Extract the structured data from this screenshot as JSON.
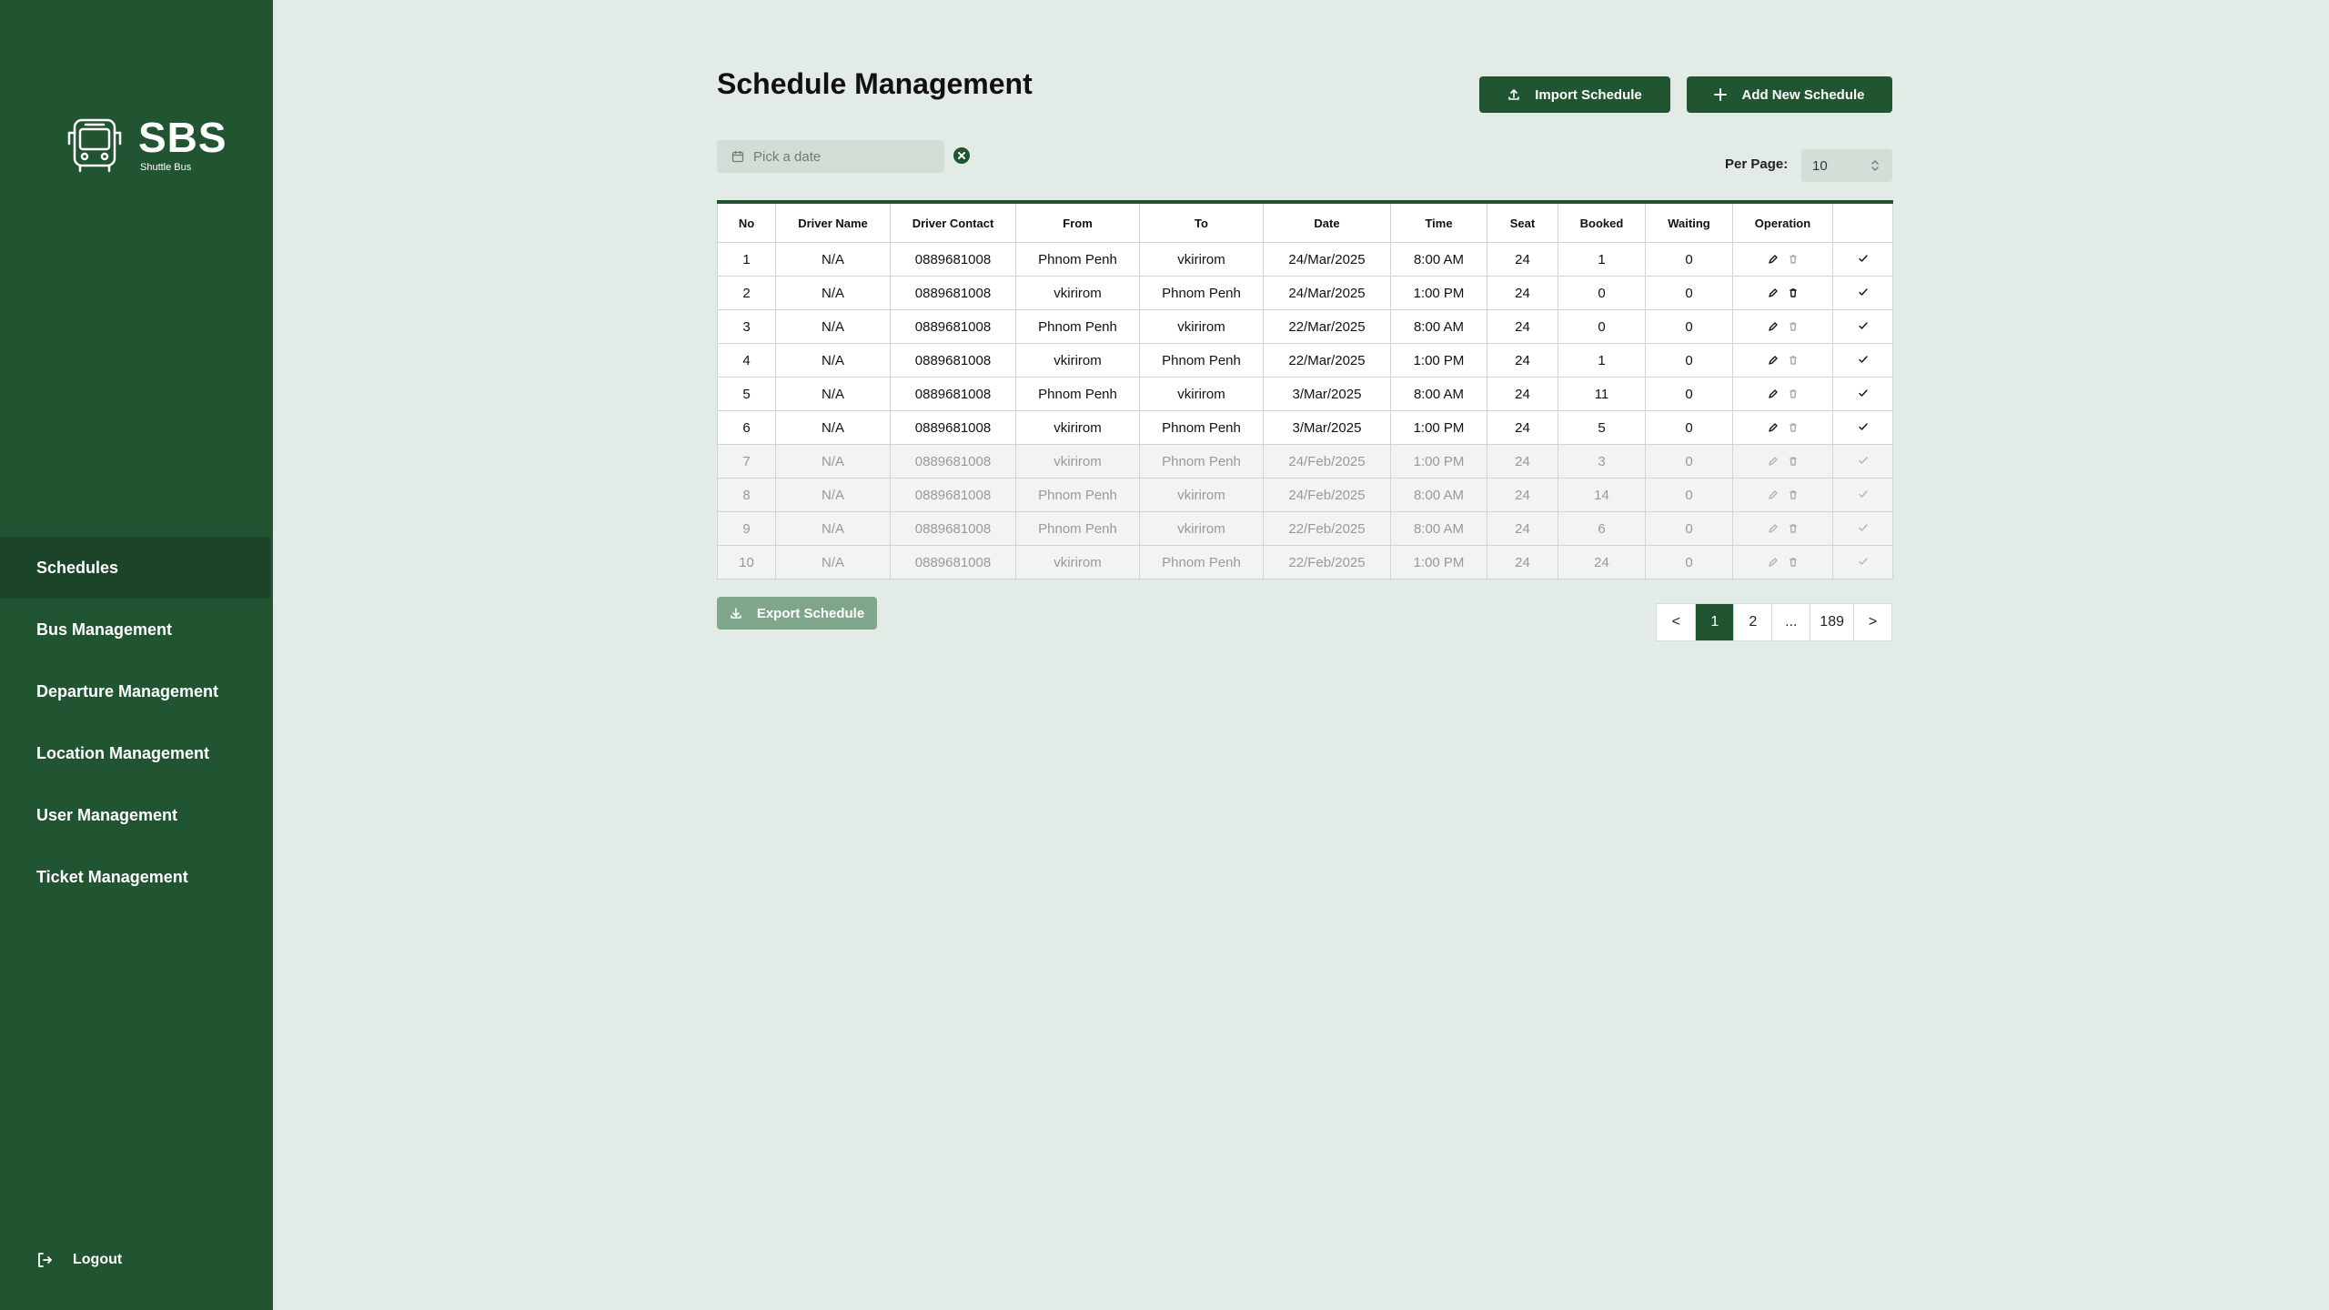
{
  "brand": {
    "name": "SBS",
    "subtitle": "Shuttle Bus"
  },
  "sidebar": {
    "items": [
      {
        "label": "Schedules",
        "active": true
      },
      {
        "label": "Bus Management"
      },
      {
        "label": "Departure Management"
      },
      {
        "label": "Location Management"
      },
      {
        "label": "User Management"
      },
      {
        "label": "Ticket Management"
      }
    ],
    "logout_label": "Logout"
  },
  "main": {
    "title": "Schedule Management",
    "import_label": "Import Schedule",
    "add_label": "Add New Schedule",
    "date_placeholder": "Pick a date",
    "per_page_label": "Per Page:",
    "per_page_value": "10",
    "export_label": "Export Schedule"
  },
  "table": {
    "columns": [
      "No",
      "Driver Name",
      "Driver Contact",
      "From",
      "To",
      "Date",
      "Time",
      "Seat",
      "Booked",
      "Waiting",
      "Operation",
      ""
    ],
    "rows": [
      {
        "cells": [
          "1",
          "N/A",
          "0889681008",
          "Phnom Penh",
          "vkirirom",
          "24/Mar/2025",
          "8:00 AM",
          "24",
          "1",
          "0"
        ],
        "muted": false
      },
      {
        "cells": [
          "2",
          "N/A",
          "0889681008",
          "vkirirom",
          "Phnom Penh",
          "24/Mar/2025",
          "1:00 PM",
          "24",
          "0",
          "0"
        ],
        "muted": false
      },
      {
        "cells": [
          "3",
          "N/A",
          "0889681008",
          "Phnom Penh",
          "vkirirom",
          "22/Mar/2025",
          "8:00 AM",
          "24",
          "0",
          "0"
        ],
        "muted": false
      },
      {
        "cells": [
          "4",
          "N/A",
          "0889681008",
          "vkirirom",
          "Phnom Penh",
          "22/Mar/2025",
          "1:00 PM",
          "24",
          "1",
          "0"
        ],
        "muted": false
      },
      {
        "cells": [
          "5",
          "N/A",
          "0889681008",
          "Phnom Penh",
          "vkirirom",
          "3/Mar/2025",
          "8:00 AM",
          "24",
          "11",
          "0"
        ],
        "muted": false
      },
      {
        "cells": [
          "6",
          "N/A",
          "0889681008",
          "vkirirom",
          "Phnom Penh",
          "3/Mar/2025",
          "1:00 PM",
          "24",
          "5",
          "0"
        ],
        "muted": false
      },
      {
        "cells": [
          "7",
          "N/A",
          "0889681008",
          "vkirirom",
          "Phnom Penh",
          "24/Feb/2025",
          "1:00 PM",
          "24",
          "3",
          "0"
        ],
        "muted": true
      },
      {
        "cells": [
          "8",
          "N/A",
          "0889681008",
          "Phnom Penh",
          "vkirirom",
          "24/Feb/2025",
          "8:00 AM",
          "24",
          "14",
          "0"
        ],
        "muted": true
      },
      {
        "cells": [
          "9",
          "N/A",
          "0889681008",
          "Phnom Penh",
          "vkirirom",
          "22/Feb/2025",
          "8:00 AM",
          "24",
          "6",
          "0"
        ],
        "muted": true
      },
      {
        "cells": [
          "10",
          "N/A",
          "0889681008",
          "vkirirom",
          "Phnom Penh",
          "22/Feb/2025",
          "1:00 PM",
          "24",
          "24",
          "0"
        ],
        "muted": true
      }
    ]
  },
  "pagination": {
    "prev": "<",
    "pages": [
      "1",
      "2",
      "...",
      "189"
    ],
    "current": "1",
    "next": ">"
  },
  "colors": {
    "sidebar": "#215431",
    "background": "#e3ebe6",
    "accent": "#215431",
    "export_disabled": "#7fa68a"
  },
  "icons": [
    "bus-logo-icon",
    "calendar-icon",
    "clear-icon",
    "sort-arrows-icon",
    "upload-icon",
    "plus-icon",
    "edit-icon",
    "delete-icon",
    "check-icon",
    "download-icon",
    "logout-icon"
  ]
}
